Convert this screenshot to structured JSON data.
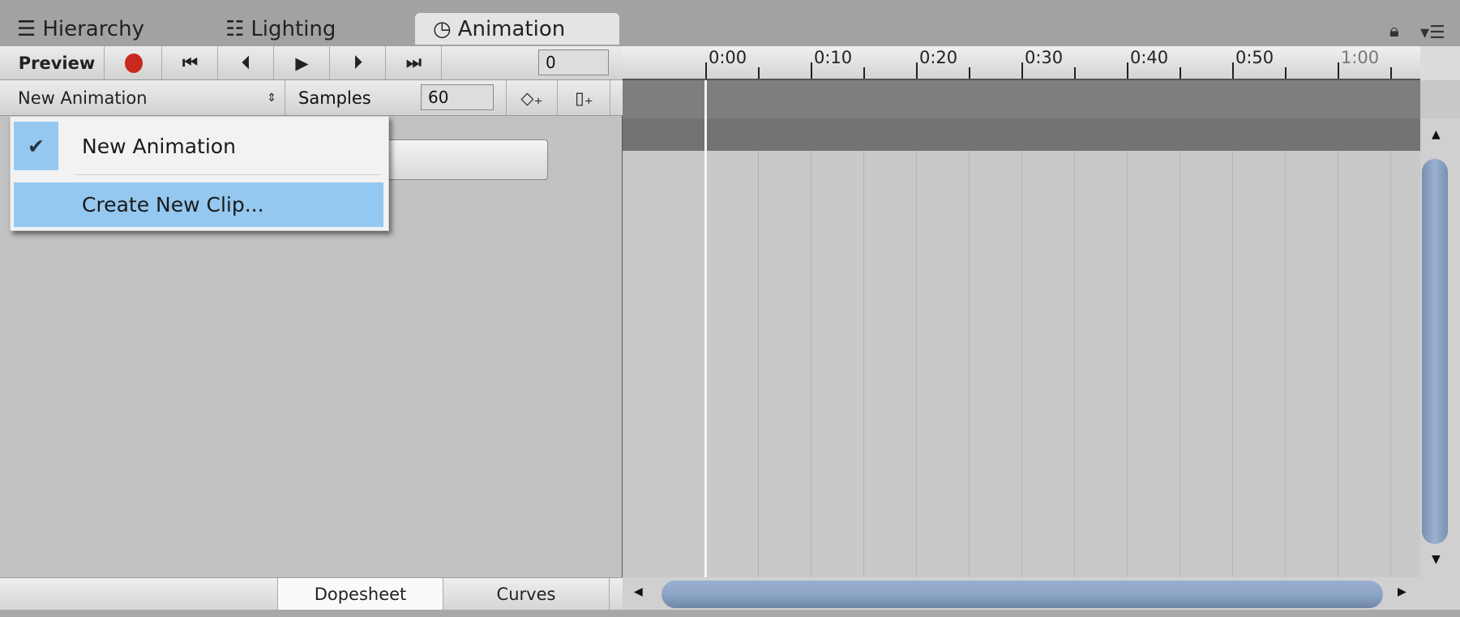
{
  "tabs": [
    {
      "label": "Hierarchy",
      "icon": "hierarchy-icon"
    },
    {
      "label": "Lighting",
      "icon": "lighting-icon"
    },
    {
      "label": "Animation",
      "icon": "clock-icon",
      "active": true
    }
  ],
  "toolbar": {
    "preview": "Preview",
    "frame": "0",
    "clip": "New Animation",
    "samples_label": "Samples",
    "samples": "60"
  },
  "menu": {
    "items": [
      {
        "label": "New Animation",
        "checked": true
      },
      {
        "label": "Create New Clip...",
        "highlighted": true
      }
    ]
  },
  "ruler": {
    "ticks": [
      "0:00",
      "0:10",
      "0:20",
      "0:30",
      "0:40",
      "0:50",
      "1:00"
    ]
  },
  "bottom": {
    "dopesheet": "Dopesheet",
    "curves": "Curves"
  },
  "colors": {
    "record": "#c8281e",
    "highlight": "#94c8f0",
    "scrollbar": "#8ea6c8"
  }
}
